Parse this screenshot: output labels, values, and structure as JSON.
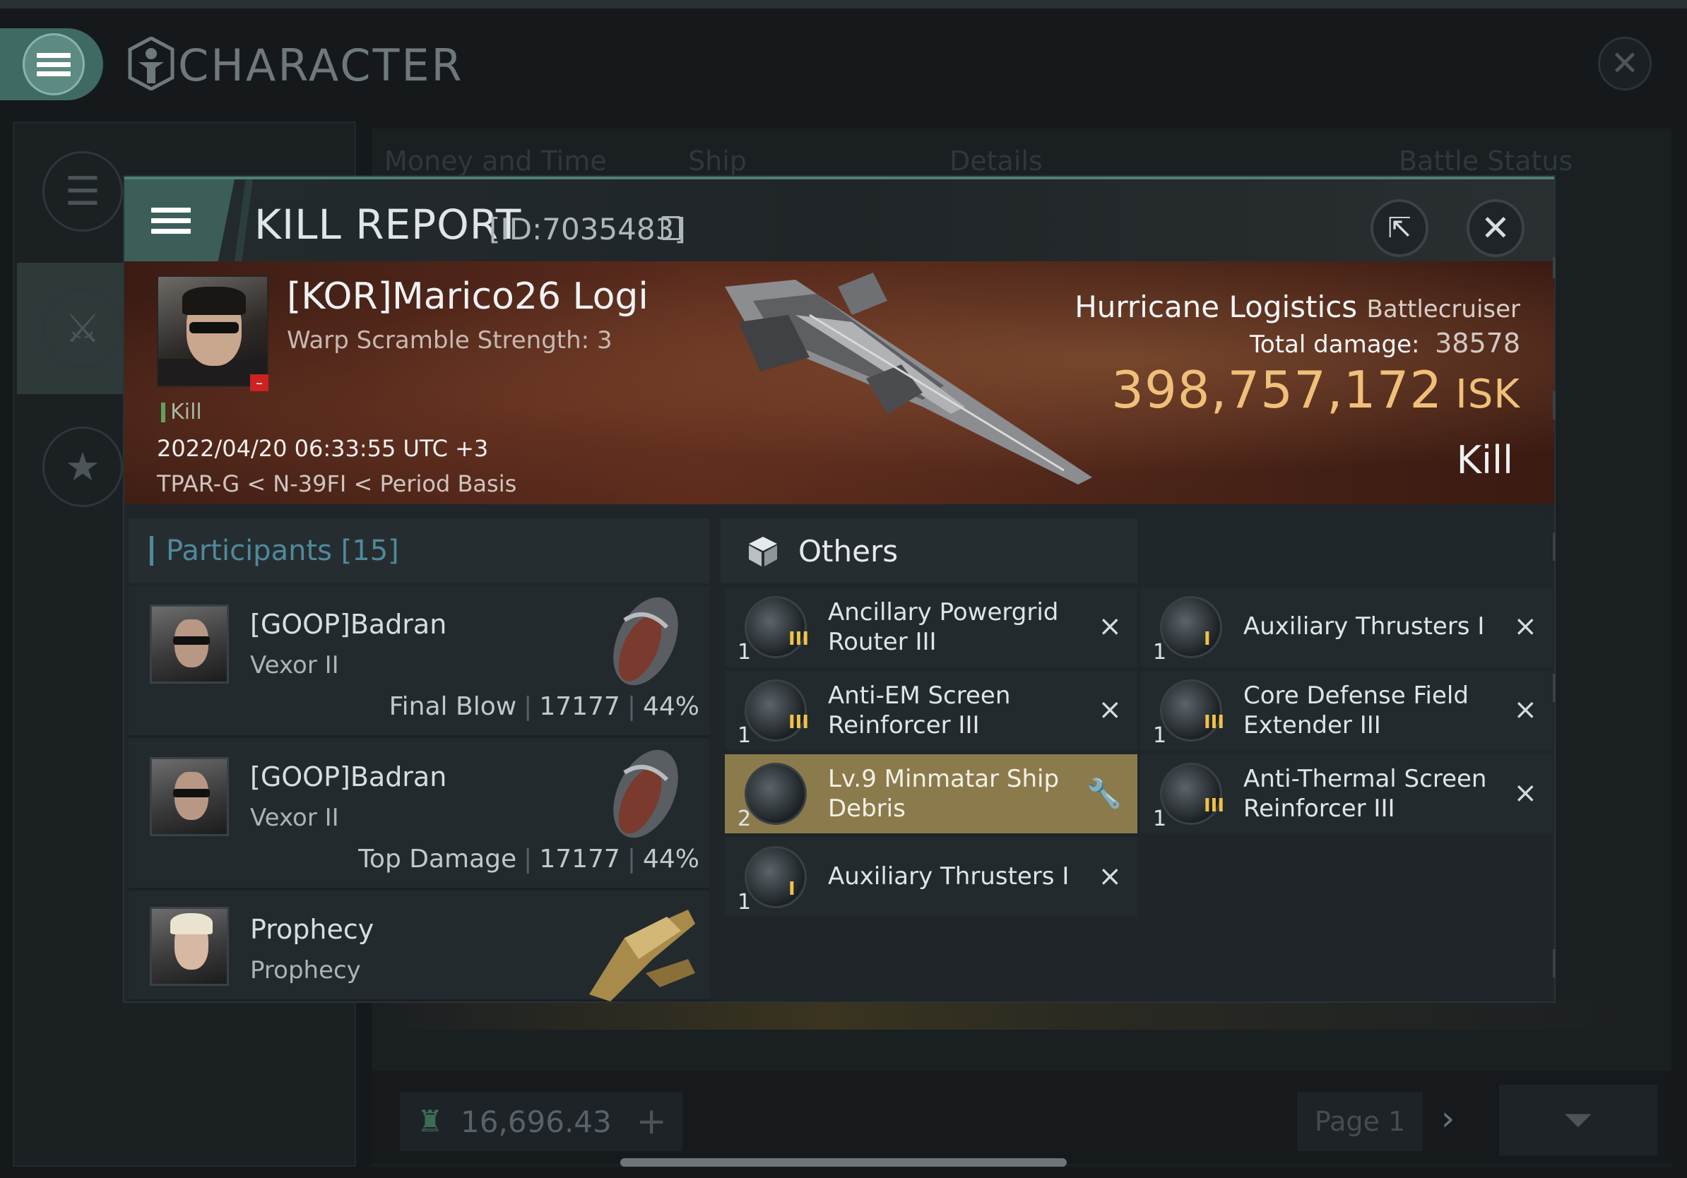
{
  "background": {
    "title": "CHARACTER",
    "columns": [
      "Money and Time",
      "Ship",
      "Details",
      "Battle Status"
    ],
    "balance": "16,696.43",
    "page": "Page 1"
  },
  "modal": {
    "title": "KILL REPORT",
    "report_id": "[ID:7035483]",
    "victim": {
      "name": "[KOR]Marico26 Logi",
      "warp_scramble": "Warp Scramble Strength: 3",
      "tag": "Kill",
      "time": "2022/04/20 06:33:55 UTC +3",
      "location": "TPAR-G < N-39FI < Period Basis"
    },
    "ship": {
      "name": "Hurricane Logistics",
      "class": "Battlecruiser",
      "total_damage_label": "Total damage:",
      "total_damage": "38578",
      "isk_value": "398,757,172",
      "isk_unit": "ISK",
      "result": "Kill"
    },
    "participants": {
      "title": "Participants [15]",
      "list": [
        {
          "name": "[GOOP]Badran",
          "ship": "Vexor II",
          "role": "Final Blow",
          "damage": "17177",
          "percent": "44%"
        },
        {
          "name": "[GOOP]Badran",
          "ship": "Vexor II",
          "role": "Top Damage",
          "damage": "17177",
          "percent": "44%"
        },
        {
          "name": "Prophecy",
          "ship": "Prophecy"
        }
      ]
    },
    "others": {
      "title": "Others",
      "items": [
        {
          "name": "Ancillary Powergrid Router III",
          "qty": "1",
          "tier": "III",
          "action": "×",
          "icon": "powergrid-router-icon"
        },
        {
          "name": "Auxiliary Thrusters I",
          "qty": "1",
          "tier": "I",
          "action": "×",
          "icon": "thruster-icon"
        },
        {
          "name": "Anti-EM Screen Reinforcer III",
          "qty": "1",
          "tier": "III",
          "action": "×",
          "icon": "shield-rig-icon"
        },
        {
          "name": "Core Defense Field Extender III",
          "qty": "1",
          "tier": "III",
          "action": "×",
          "icon": "shield-rig-icon"
        },
        {
          "name": "Lv.9 Minmatar Ship Debris",
          "qty": "2",
          "tier": "",
          "action": "🔧",
          "icon": "debris-icon"
        },
        {
          "name": "Anti-Thermal Screen Reinforcer III",
          "qty": "1",
          "tier": "III",
          "action": "×",
          "icon": "shield-rig-icon"
        },
        {
          "name": "Auxiliary Thrusters I",
          "qty": "1",
          "tier": "I",
          "action": "×",
          "icon": "thruster-icon"
        }
      ]
    }
  }
}
